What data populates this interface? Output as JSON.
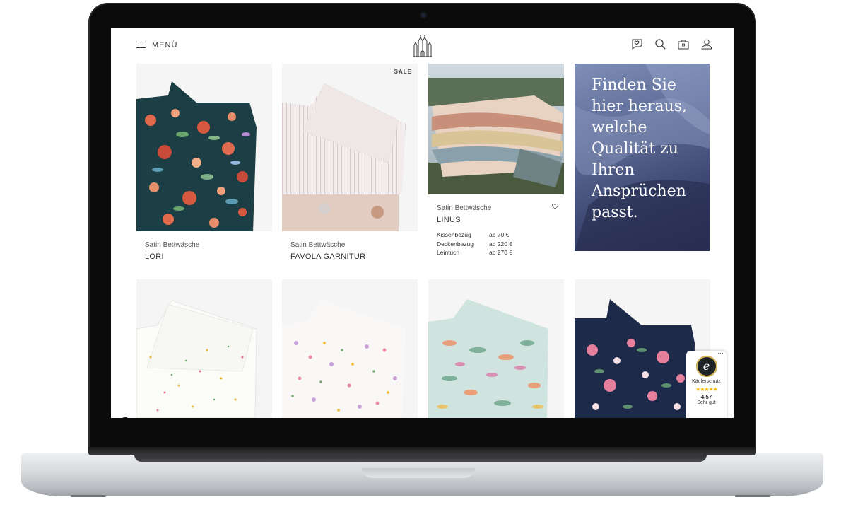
{
  "header": {
    "menu_label": "MENÜ",
    "icons": [
      "wishlist-icon",
      "search-icon",
      "bag-icon",
      "account-icon"
    ]
  },
  "products_row1": [
    {
      "category": "Satin Bettwäsche",
      "name": "LORI"
    },
    {
      "category": "Satin Bettwäsche",
      "name": "FAVOLA GARNITUR",
      "badge": "SALE"
    },
    {
      "category": "Satin Bettwäsche",
      "name": "LINUS",
      "prices": [
        {
          "label": "Kissenbezug",
          "value": "ab 70 €"
        },
        {
          "label": "Deckenbezug",
          "value": "ab 220 €"
        },
        {
          "label": "Leintuch",
          "value": "ab 270 €"
        }
      ]
    }
  ],
  "promo": {
    "text": "Finden Sie hier heraus, welche Qualität zu Ihren Ansprüchen passt."
  },
  "trust_badge": {
    "label": "Käuferschutz",
    "rating": "4,57",
    "rating_text": "Sehr gut",
    "stars": "★★★★★"
  },
  "colors": {
    "lori_bg": "#1c3f45",
    "promo_bg": "#4a5582",
    "star": "#f5b700"
  }
}
